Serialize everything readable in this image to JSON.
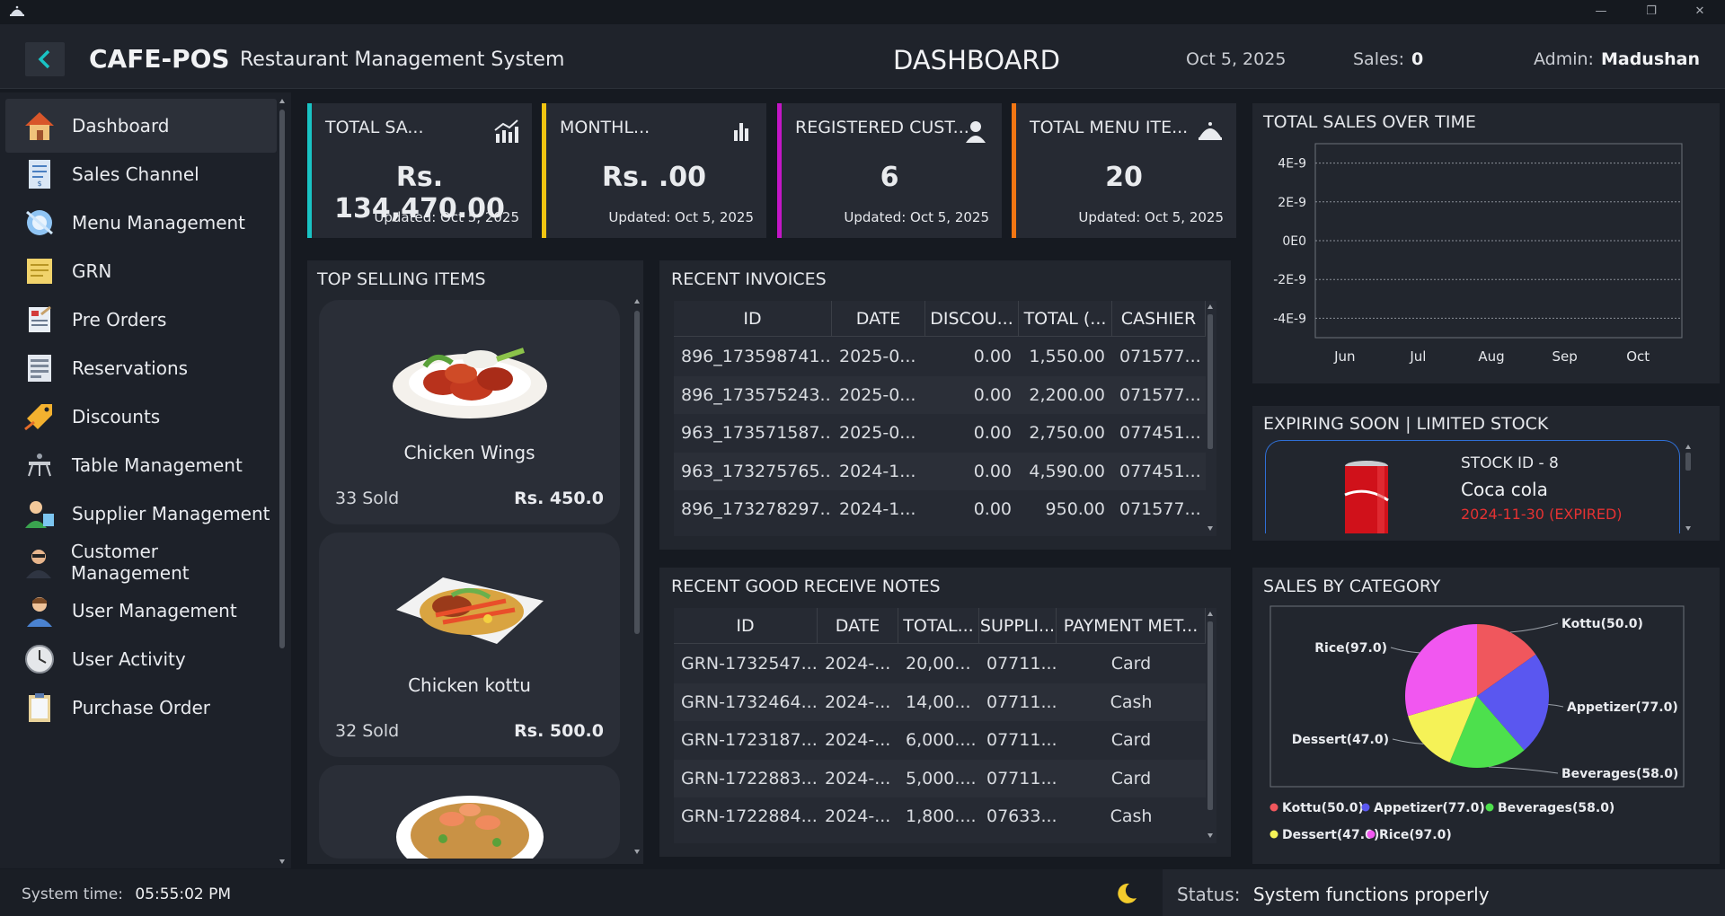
{
  "header": {
    "brand": "CAFE-POS",
    "subtitle": "Restaurant Management System",
    "page_title": "DASHBOARD",
    "date": "Oct 5, 2025",
    "sales_label": "Sales:",
    "sales_value": "0",
    "admin_label": "Admin:",
    "admin_name": "Madushan"
  },
  "sidebar": {
    "items": [
      {
        "label": "Dashboard",
        "icon": "home-icon",
        "active": true
      },
      {
        "label": "Sales Channel",
        "icon": "receipt-icon"
      },
      {
        "label": "Menu Management",
        "icon": "menu-book-icon"
      },
      {
        "label": "GRN",
        "icon": "note-icon"
      },
      {
        "label": "Pre Orders",
        "icon": "clipboard-icon"
      },
      {
        "label": "Reservations",
        "icon": "calendar-icon"
      },
      {
        "label": "Discounts",
        "icon": "tag-icon"
      },
      {
        "label": "Table Management",
        "icon": "table-icon"
      },
      {
        "label": "Supplier Management",
        "icon": "supplier-icon"
      },
      {
        "label": "Customer Management",
        "icon": "customer-icon"
      },
      {
        "label": "User Management",
        "icon": "user-icon"
      },
      {
        "label": "User Activity",
        "icon": "clock-icon"
      },
      {
        "label": "Purchase Order",
        "icon": "purchase-order-icon"
      }
    ]
  },
  "cards": [
    {
      "title": "TOTAL SA...",
      "value": "Rs. 134,470.00",
      "updated": "Updated: Oct 5, 2025",
      "color": "#19c3c4",
      "icon": "line-chart-icon"
    },
    {
      "title": "MONTHL...",
      "value": "Rs. .00",
      "updated": "Updated: Oct 5, 2025",
      "color": "#f2c511",
      "icon": "bar-chart-icon"
    },
    {
      "title": "REGISTERED CUST...",
      "value": "6",
      "updated": "Updated: Oct 5, 2025",
      "color": "#c316c6",
      "icon": "person-icon"
    },
    {
      "title": "TOTAL MENU ITE...",
      "value": "20",
      "updated": "Updated: Oct 5, 2025",
      "color": "#f27613",
      "icon": "cloche-icon"
    }
  ],
  "top_selling": {
    "title": "TOP SELLING ITEMS",
    "items": [
      {
        "name": "Chicken Wings",
        "sold": "33 Sold",
        "price": "Rs. 450.0"
      },
      {
        "name": "Chicken kottu",
        "sold": "32 Sold",
        "price": "Rs. 500.0"
      },
      {
        "name": "",
        "sold": "",
        "price": ""
      }
    ]
  },
  "invoices": {
    "title": "RECENT INVOICES",
    "columns": [
      "ID",
      "DATE",
      "DISCOU...",
      "TOTAL (...",
      "CASHIER"
    ],
    "rows": [
      [
        "896_173598741...",
        "2025-0...",
        "0.00",
        "1,550.00",
        "071577..."
      ],
      [
        "896_173575243...",
        "2025-0...",
        "0.00",
        "2,200.00",
        "071577..."
      ],
      [
        "963_173571587...",
        "2025-0...",
        "0.00",
        "2,750.00",
        "077451..."
      ],
      [
        "963_173275765...",
        "2024-1...",
        "0.00",
        "4,590.00",
        "077451..."
      ],
      [
        "896_173278297...",
        "2024-1...",
        "0.00",
        "950.00",
        "071577..."
      ]
    ]
  },
  "grn": {
    "title": "RECENT GOOD RECEIVE NOTES",
    "columns": [
      "ID",
      "DATE",
      "TOTAL...",
      "SUPPLI...",
      "PAYMENT MET..."
    ],
    "rows": [
      [
        "GRN-1732547...",
        "2024-...",
        "20,00...",
        "07711...",
        "Card"
      ],
      [
        "GRN-1732464...",
        "2024-...",
        "14,00...",
        "07711...",
        "Cash"
      ],
      [
        "GRN-1723187...",
        "2024-...",
        "6,000....",
        "07711...",
        "Card"
      ],
      [
        "GRN-1722883...",
        "2024-...",
        "5,000....",
        "07711...",
        "Card"
      ],
      [
        "GRN-1722884...",
        "2024-...",
        "1,800....",
        "07633...",
        "Cash"
      ]
    ]
  },
  "sales_chart": {
    "title": "TOTAL SALES OVER TIME"
  },
  "expiring": {
    "title": "EXPIRING SOON | LIMITED STOCK",
    "stock_id": "STOCK ID - 8",
    "name": "Coca cola",
    "date": "2024-11-30 (EXPIRED)",
    "expired_color": "#e53232"
  },
  "category": {
    "title": "SALES BY CATEGORY"
  },
  "chart_data": [
    {
      "type": "line",
      "title": "TOTAL SALES OVER TIME",
      "x": [
        "Jun",
        "Jul",
        "Aug",
        "Sep",
        "Oct"
      ],
      "y_ticks": [
        "4E-9",
        "2E-9",
        "0E0",
        "-2E-9",
        "-4E-9"
      ],
      "ylim": [
        -5e-09,
        5e-09
      ],
      "grid": true,
      "series": []
    },
    {
      "type": "pie",
      "title": "SALES BY CATEGORY",
      "slices": [
        {
          "label": "Kottu(50.0)",
          "legend": "Kottu(50.0)",
          "value": 50.0,
          "color": "#f0575d"
        },
        {
          "label": "Appetizer(77.0)",
          "legend": "Appetizer(77.0)",
          "value": 77.0,
          "color": "#5a57f0"
        },
        {
          "label": "Beverages(58.0)",
          "legend": "Beverages(58.0)",
          "value": 58.0,
          "color": "#4de04d"
        },
        {
          "label": "Dessert(47.0)",
          "legend": "Dessert(47.0)",
          "value": 47.0,
          "color": "#f5f257"
        },
        {
          "label": "Rice(97.0)",
          "legend": "Rice(97.0)",
          "value": 97.0,
          "color": "#f157f0"
        }
      ],
      "legend_position": "bottom"
    }
  ],
  "status_bar": {
    "time_label": "System time:",
    "time": "05:55:02 PM",
    "status_label": "Status:",
    "status": "System functions properly"
  }
}
